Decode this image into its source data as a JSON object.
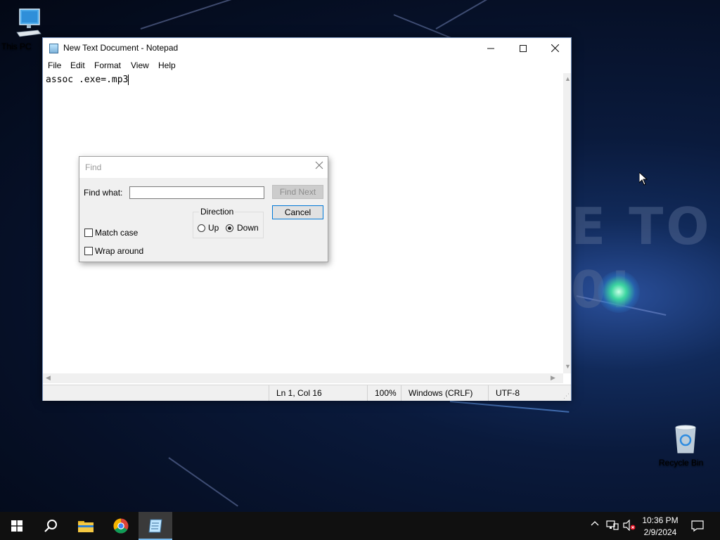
{
  "desktop": {
    "icons": [
      {
        "label": "This PC"
      },
      {
        "label": "Recycle Bin"
      }
    ],
    "wallpaper_text_1": "E TO",
    "wallpaper_text_2": "0!"
  },
  "notepad": {
    "title": "New Text Document - Notepad",
    "menu": [
      "File",
      "Edit",
      "Format",
      "View",
      "Help"
    ],
    "content": "assoc .exe=.mp3",
    "status": {
      "position": "Ln 1, Col 16",
      "zoom": "100%",
      "line_ending": "Windows (CRLF)",
      "encoding": "UTF-8"
    }
  },
  "find_dialog": {
    "title": "Find",
    "find_what_label": "Find what:",
    "find_what_value": "",
    "find_next_label": "Find Next",
    "cancel_label": "Cancel",
    "direction_label": "Direction",
    "up_label": "Up",
    "down_label": "Down",
    "direction_selected": "Down",
    "match_case_label": "Match case",
    "match_case_checked": false,
    "wrap_around_label": "Wrap around",
    "wrap_around_checked": false
  },
  "taskbar": {
    "clock_time": "10:36 PM",
    "clock_date": "2/9/2024"
  },
  "colors": {
    "taskbar_bg": "#101010",
    "active_indicator": "#76b9ed",
    "dialog_bg": "#f0f0f0",
    "default_button_border": "#0078d7"
  }
}
